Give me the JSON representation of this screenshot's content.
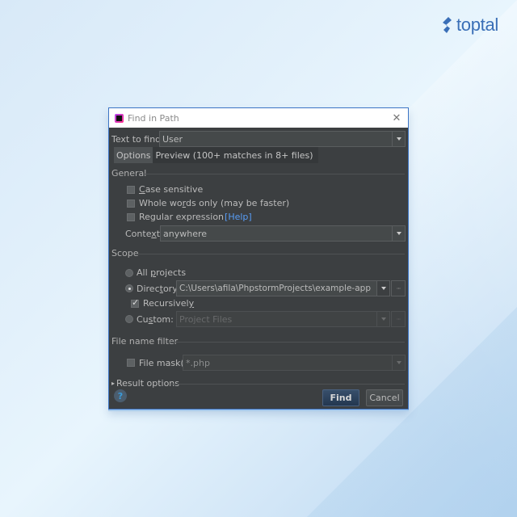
{
  "logo": {
    "text": "toptal",
    "color": "#3a6fb7"
  },
  "dialog": {
    "title": "Find in Path",
    "close_label": "✕",
    "text_to_find_label": "Text to find:",
    "text_to_find_value": "User",
    "tabs": [
      {
        "label": "Options",
        "active": true
      },
      {
        "label": "Preview (100+ matches in 8+ files)",
        "active": false
      }
    ],
    "general": {
      "title": "General",
      "case_sensitive": {
        "label_underline": "C",
        "label_rest": "ase sensitive",
        "checked": false
      },
      "whole_words": {
        "label_pre": "Whole wo",
        "label_underline": "r",
        "label_rest": "ds only (may be faster)",
        "checked": false
      },
      "regex": {
        "label": "Regular expression",
        "help_link": "[Help]",
        "checked": false
      },
      "context_label_pre": "Conte",
      "context_label_underline": "x",
      "context_label_post": "t:",
      "context_value": "anywhere"
    },
    "scope": {
      "title": "Scope",
      "all_projects": {
        "label_pre": "All ",
        "label_underline": "p",
        "label_rest": "rojects",
        "selected": false
      },
      "directory": {
        "label_pre": "Direc",
        "label_underline": "t",
        "label_rest": "ory:",
        "selected": true,
        "value": "C:\\Users\\afila\\PhpstormProjects\\example-app"
      },
      "recursively": {
        "label_pre": "Recursivel",
        "label_underline": "y",
        "checked": true
      },
      "custom": {
        "label_pre": "Cu",
        "label_underline": "s",
        "label_rest": "tom:",
        "selected": false,
        "value": "Project Files"
      },
      "browse_label": "···"
    },
    "file_filter": {
      "title": "File name filter",
      "file_mask_label": "File mask(s)",
      "file_mask_checked": false,
      "file_mask_value": "*.php"
    },
    "result_options": {
      "label": "Result options",
      "arrow": "▸"
    },
    "help_label": "?",
    "find_label": "Find",
    "cancel_label": "Cancel"
  }
}
